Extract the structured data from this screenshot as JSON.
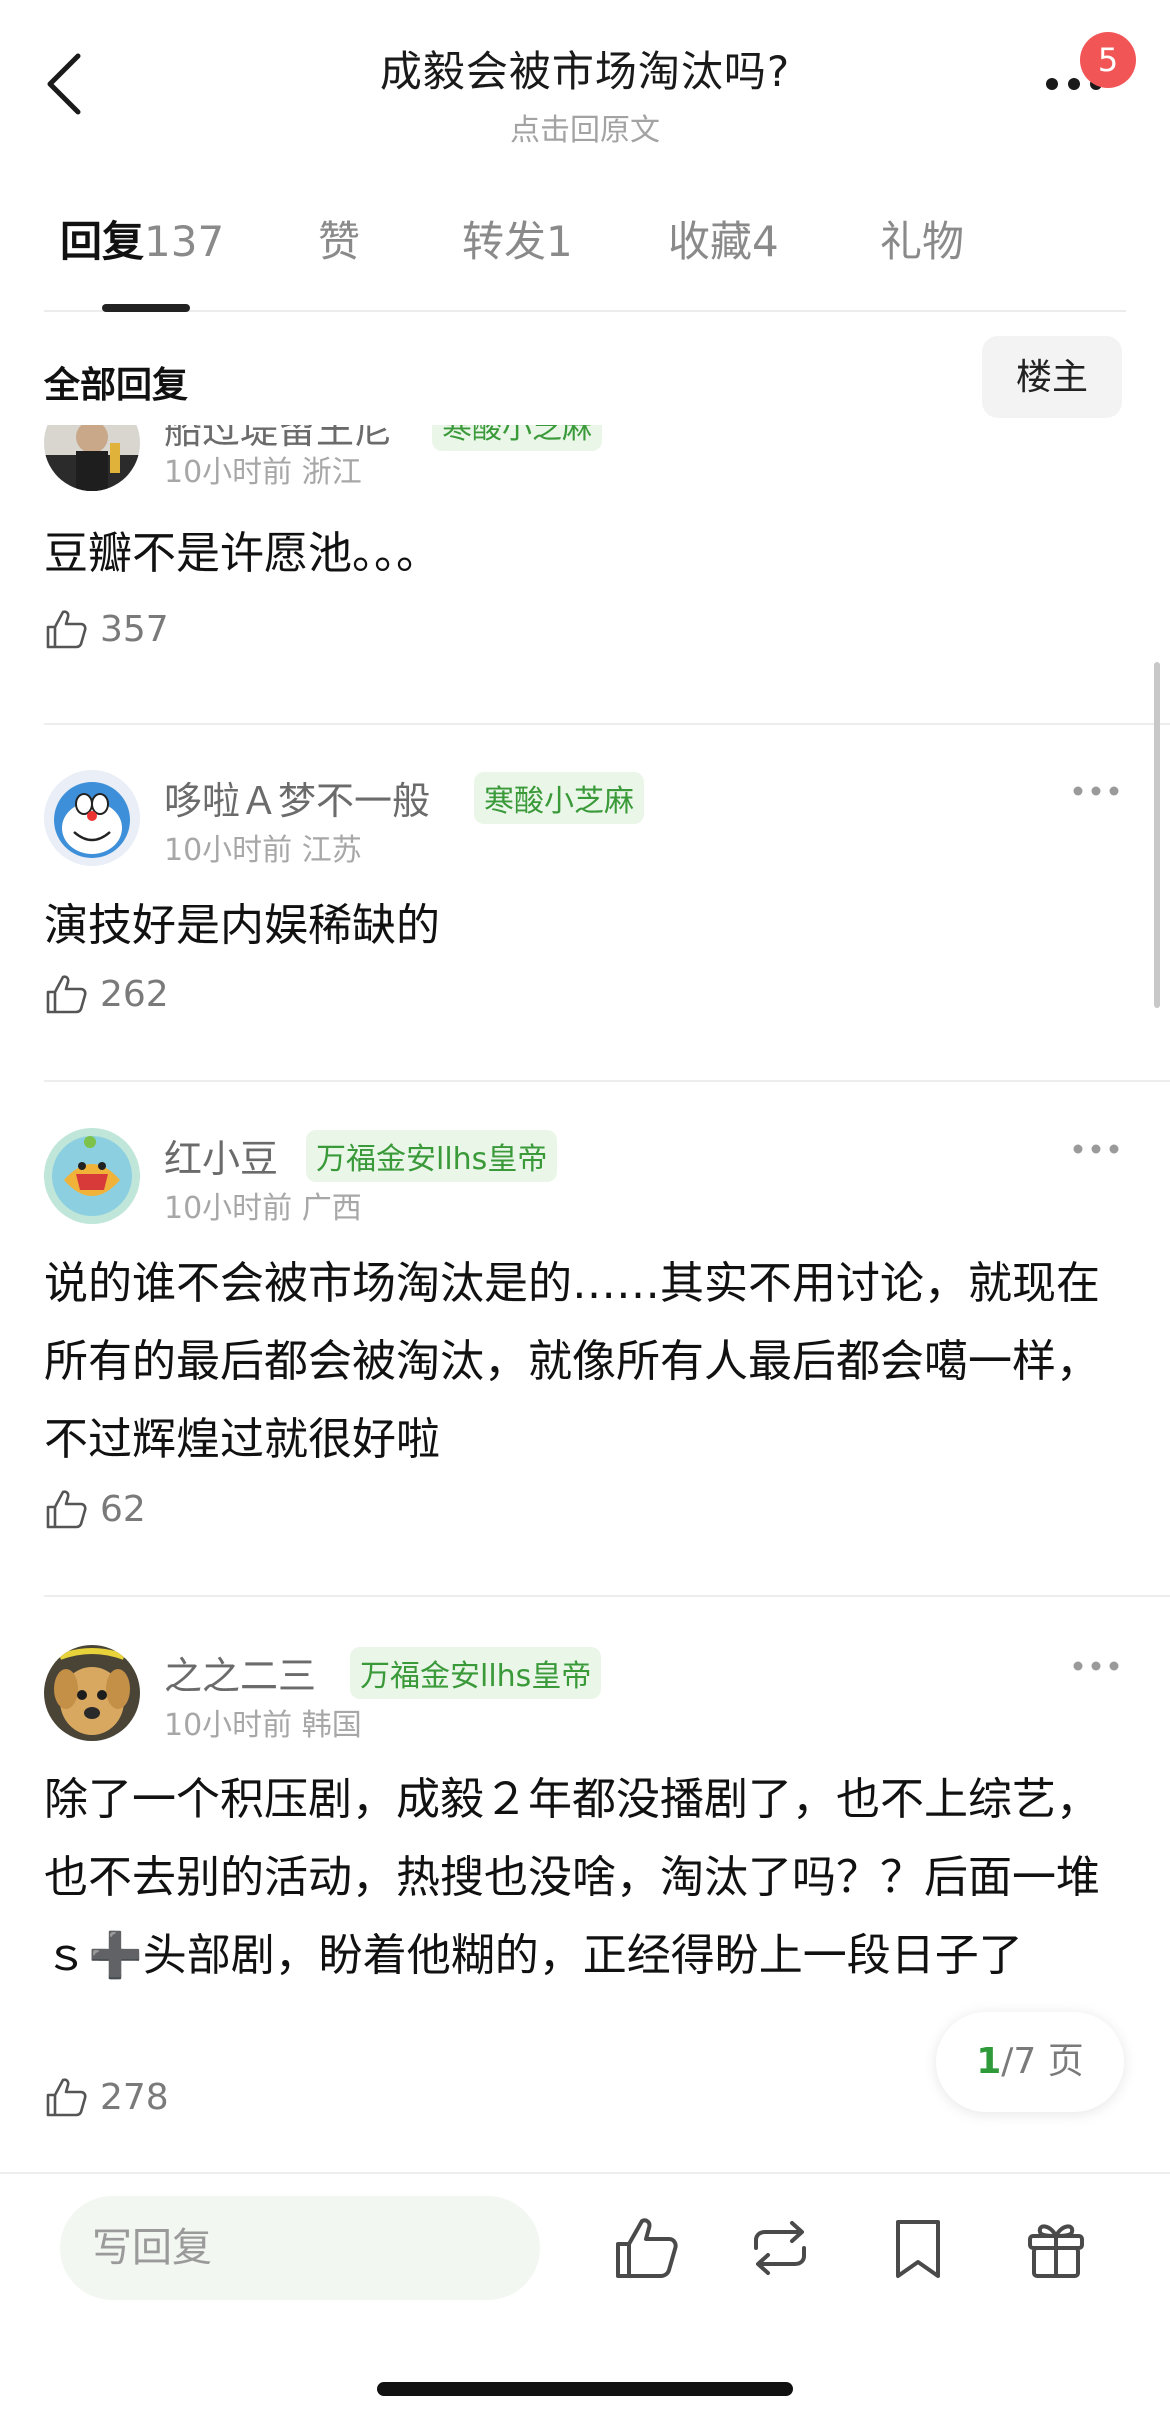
{
  "header": {
    "title": "成毅会被市场淘汰吗?",
    "subtitle": "点击回原文",
    "badge_count": "5",
    "badge_color": "#f25555"
  },
  "tabs": [
    {
      "label": "回复",
      "count": "137",
      "active": true
    },
    {
      "label": "赞",
      "count": "",
      "active": false
    },
    {
      "label": "转发",
      "count": "1",
      "active": false
    },
    {
      "label": "收藏",
      "count": "4",
      "active": false
    },
    {
      "label": "礼物",
      "count": "",
      "active": false
    }
  ],
  "section": {
    "title": "全部回复",
    "filter_button": "楼主"
  },
  "comments": [
    {
      "name": "船过堤留王尼",
      "tag": "寒酸小芝麻",
      "time": "10小时前",
      "location": "浙江",
      "body": "豆瓣不是许愿池。。。",
      "likes": "357"
    },
    {
      "name": "哆啦Ａ梦不一般",
      "tag": "寒酸小芝麻",
      "time": "10小时前",
      "location": "江苏",
      "body": "演技好是内娱稀缺的",
      "likes": "262"
    },
    {
      "name": "红小豆",
      "tag": "万福金安llhs皇帝",
      "time": "10小时前",
      "location": "广西",
      "body": "说的谁不会被市场淘汰是的……其实不用讨论，就现在所有的最后都会被淘汰，就像所有人最后都会噶一样，不过辉煌过就很好啦",
      "likes": "62"
    },
    {
      "name": "之之二三",
      "tag": "万福金安llhs皇帝",
      "time": "10小时前",
      "location": "韩国",
      "body": "除了一个积压剧，成毅２年都没播剧了，也不上综艺，也不去别的活动，热搜也没啥，淘汰了吗？？后面一堆ｓ➕头部剧，盼着他糊的，正经得盼上一段日子了",
      "likes": "278"
    }
  ],
  "pagination": {
    "current": "1",
    "total_text": "/7 页",
    "accent_color": "#2e9a3a"
  },
  "bottom_bar": {
    "reply_placeholder": "写回复",
    "icons": [
      "thumbs-up-icon",
      "repost-icon",
      "bookmark-icon",
      "gift-icon"
    ]
  },
  "tag_color": "#3a9a3a"
}
